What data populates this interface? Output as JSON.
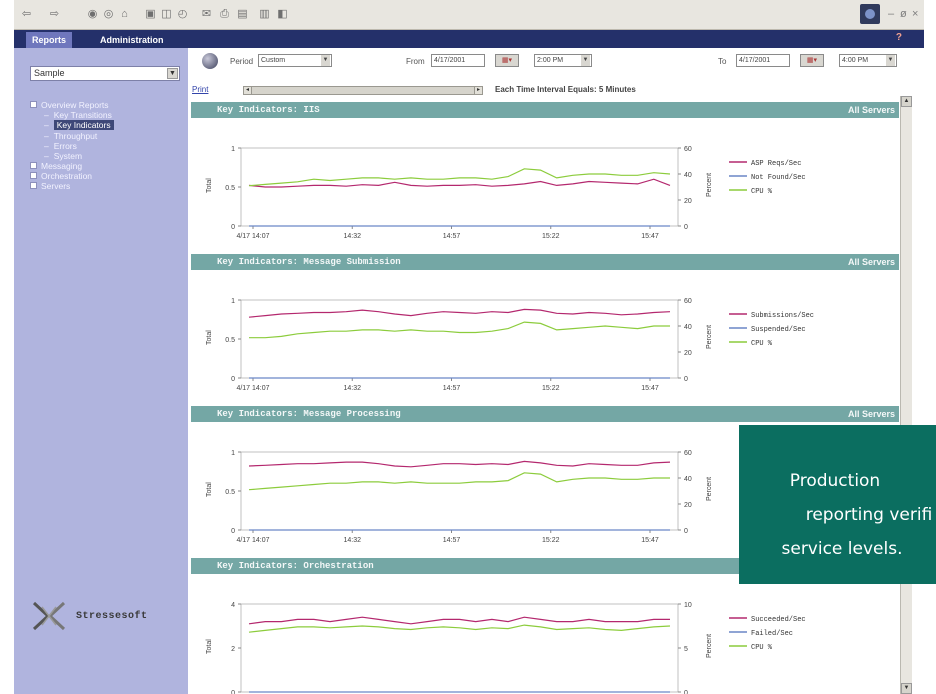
{
  "toolbar": {
    "icons": [
      "back-icon",
      "forward-icon",
      "stop-icon",
      "refresh-icon",
      "home-icon",
      "search-icon",
      "favorites-icon",
      "history-icon",
      "mail-icon",
      "print-icon",
      "edit-icon",
      "discuss-icon",
      "messenger-icon"
    ],
    "window_min": "–",
    "window_max": "ø",
    "window_close": "×"
  },
  "tabs": [
    "Reports",
    "Administration"
  ],
  "help": "?",
  "sidebar": {
    "project": "Sample",
    "tree": [
      {
        "label": "Overview Reports",
        "level": 0
      },
      {
        "label": "Key Transitions",
        "level": 1
      },
      {
        "label": "Key Indicators",
        "level": 1,
        "selected": true
      },
      {
        "label": "Throughput",
        "level": 1
      },
      {
        "label": "Errors",
        "level": 1
      },
      {
        "label": "System",
        "level": 1
      },
      {
        "label": "Messaging",
        "level": 0
      },
      {
        "label": "Orchestration",
        "level": 0
      },
      {
        "label": "Servers",
        "level": 0
      }
    ],
    "brand": "Stressesoft"
  },
  "controls": {
    "period_label": "Period",
    "period_value": "Custom",
    "from_label": "From",
    "from_date": "4/17/2001",
    "from_time": "2:00 PM",
    "to_label": "To",
    "to_date": "4/17/2001",
    "to_time": "4:00 PM",
    "print_label": "Print",
    "interval_note": "Each Time Interval Equals: 5 Minutes"
  },
  "panels": [
    {
      "title": "Key Indicators: IIS",
      "scope": "All Servers"
    },
    {
      "title": "Key Indicators: Message Submission",
      "scope": "All Servers"
    },
    {
      "title": "Key Indicators: Message Processing",
      "scope": "All Servers"
    },
    {
      "title": "Key Indicators: Orchestration",
      "scope": ""
    }
  ],
  "callout": {
    "line1": "Production",
    "line2": "reporting verifi",
    "line3": "service levels."
  },
  "chart_data": [
    {
      "type": "line",
      "title": "Key Indicators: IIS",
      "xlabel": "",
      "ylabel": "Total",
      "y2label": "Percent",
      "x": [
        "4/17 14:07",
        "14:32",
        "14:57",
        "15:22",
        "15:47"
      ],
      "ylim": [
        0,
        1
      ],
      "yticks": [
        0,
        0.5,
        1
      ],
      "y2lim": [
        0,
        60
      ],
      "y2ticks": [
        0,
        20,
        40,
        60
      ],
      "series": [
        {
          "name": "ASP Reqs/Sec",
          "color": "#b4286e",
          "axis": "left",
          "values": [
            0.52,
            0.5,
            0.5,
            0.51,
            0.52,
            0.52,
            0.51,
            0.53,
            0.52,
            0.56,
            0.52,
            0.51,
            0.52,
            0.52,
            0.53,
            0.51,
            0.52,
            0.54,
            0.57,
            0.52,
            0.54,
            0.57,
            0.56,
            0.55,
            0.54,
            0.6,
            0.52
          ]
        },
        {
          "name": "Not Found/Sec",
          "color": "#6a86c6",
          "axis": "left",
          "values": [
            0,
            0,
            0,
            0,
            0,
            0,
            0,
            0,
            0,
            0,
            0,
            0,
            0,
            0,
            0,
            0,
            0,
            0,
            0,
            0,
            0,
            0,
            0,
            0,
            0,
            0,
            0
          ]
        },
        {
          "name": "CPU %",
          "color": "#8ccc3c",
          "axis": "right",
          "values": [
            31,
            32,
            33,
            34,
            36,
            35,
            36,
            37,
            37,
            36,
            37,
            36,
            36,
            37,
            37,
            36,
            38,
            44,
            43,
            37,
            39,
            40,
            40,
            39,
            39,
            41,
            40
          ]
        }
      ]
    },
    {
      "type": "line",
      "title": "Key Indicators: Message Submission",
      "xlabel": "",
      "ylabel": "Total",
      "y2label": "Percent",
      "x": [
        "4/17 14:07",
        "14:32",
        "14:57",
        "15:22",
        "15:47"
      ],
      "ylim": [
        0,
        1
      ],
      "yticks": [
        0,
        0.5,
        1
      ],
      "y2lim": [
        0,
        60
      ],
      "y2ticks": [
        0,
        20,
        40,
        60
      ],
      "series": [
        {
          "name": "Submissions/Sec",
          "color": "#b4286e",
          "axis": "left",
          "values": [
            0.78,
            0.8,
            0.82,
            0.83,
            0.84,
            0.84,
            0.85,
            0.87,
            0.85,
            0.82,
            0.8,
            0.83,
            0.85,
            0.84,
            0.83,
            0.85,
            0.84,
            0.88,
            0.87,
            0.83,
            0.82,
            0.84,
            0.83,
            0.81,
            0.82,
            0.84,
            0.85
          ]
        },
        {
          "name": "Suspended/Sec",
          "color": "#6a86c6",
          "axis": "left",
          "values": [
            0,
            0,
            0,
            0,
            0,
            0,
            0,
            0,
            0,
            0,
            0,
            0,
            0,
            0,
            0,
            0,
            0,
            0,
            0,
            0,
            0,
            0,
            0,
            0,
            0,
            0,
            0
          ]
        },
        {
          "name": "CPU %",
          "color": "#8ccc3c",
          "axis": "right",
          "values": [
            31,
            31,
            32,
            34,
            35,
            36,
            36,
            37,
            37,
            36,
            37,
            36,
            36,
            35,
            35,
            36,
            38,
            43,
            42,
            37,
            38,
            39,
            40,
            39,
            38,
            40,
            40
          ]
        }
      ]
    },
    {
      "type": "line",
      "title": "Key Indicators: Message Processing",
      "xlabel": "",
      "ylabel": "Total",
      "y2label": "Percent",
      "x": [
        "4/17 14:07",
        "14:32",
        "14:57",
        "15:22",
        "15:47"
      ],
      "ylim": [
        0,
        1
      ],
      "yticks": [
        0,
        0.5,
        1
      ],
      "y2lim": [
        0,
        60
      ],
      "y2ticks": [
        0,
        20,
        40,
        60
      ],
      "series": [
        {
          "name": "",
          "color": "#b4286e",
          "axis": "left",
          "values": [
            0.82,
            0.83,
            0.84,
            0.85,
            0.85,
            0.86,
            0.87,
            0.87,
            0.85,
            0.82,
            0.81,
            0.83,
            0.85,
            0.85,
            0.84,
            0.85,
            0.84,
            0.88,
            0.86,
            0.83,
            0.82,
            0.85,
            0.84,
            0.83,
            0.83,
            0.86,
            0.87
          ]
        },
        {
          "name": "",
          "color": "#6a86c6",
          "axis": "left",
          "values": [
            0,
            0,
            0,
            0,
            0,
            0,
            0,
            0,
            0,
            0,
            0,
            0,
            0,
            0,
            0,
            0,
            0,
            0,
            0,
            0,
            0,
            0,
            0,
            0,
            0,
            0,
            0
          ]
        },
        {
          "name": "",
          "color": "#8ccc3c",
          "axis": "right",
          "values": [
            31,
            32,
            33,
            34,
            35,
            36,
            36,
            37,
            37,
            36,
            37,
            36,
            36,
            36,
            37,
            37,
            38,
            44,
            43,
            37,
            39,
            40,
            40,
            39,
            39,
            40,
            40
          ]
        }
      ]
    },
    {
      "type": "line",
      "title": "Key Indicators: Orchestration",
      "xlabel": "",
      "ylabel": "Total",
      "y2label": "Percent",
      "x": [],
      "ylim": [
        0,
        4
      ],
      "yticks": [
        0,
        2,
        4
      ],
      "y2lim": [
        0,
        10
      ],
      "y2ticks": [
        0,
        5,
        10
      ],
      "series": [
        {
          "name": "Succeeded/Sec",
          "color": "#b4286e",
          "axis": "left",
          "values": [
            3.1,
            3.2,
            3.2,
            3.3,
            3.3,
            3.2,
            3.3,
            3.4,
            3.3,
            3.2,
            3.1,
            3.2,
            3.3,
            3.3,
            3.2,
            3.3,
            3.2,
            3.4,
            3.3,
            3.2,
            3.2,
            3.3,
            3.2,
            3.2,
            3.2,
            3.3,
            3.3
          ]
        },
        {
          "name": "Failed/Sec",
          "color": "#6a86c6",
          "axis": "left",
          "values": [
            0,
            0,
            0,
            0,
            0,
            0,
            0,
            0,
            0,
            0,
            0,
            0,
            0,
            0,
            0,
            0,
            0,
            0,
            0,
            0,
            0,
            0,
            0,
            0,
            0,
            0,
            0
          ]
        },
        {
          "name": "CPU %",
          "color": "#8ccc3c",
          "axis": "right",
          "values": [
            6.8,
            7.0,
            7.2,
            7.4,
            7.4,
            7.3,
            7.4,
            7.5,
            7.4,
            7.2,
            7.1,
            7.3,
            7.4,
            7.3,
            7.1,
            7.3,
            7.2,
            7.6,
            7.4,
            7.1,
            7.2,
            7.3,
            7.1,
            7.0,
            7.2,
            7.4,
            7.5
          ]
        }
      ]
    }
  ]
}
